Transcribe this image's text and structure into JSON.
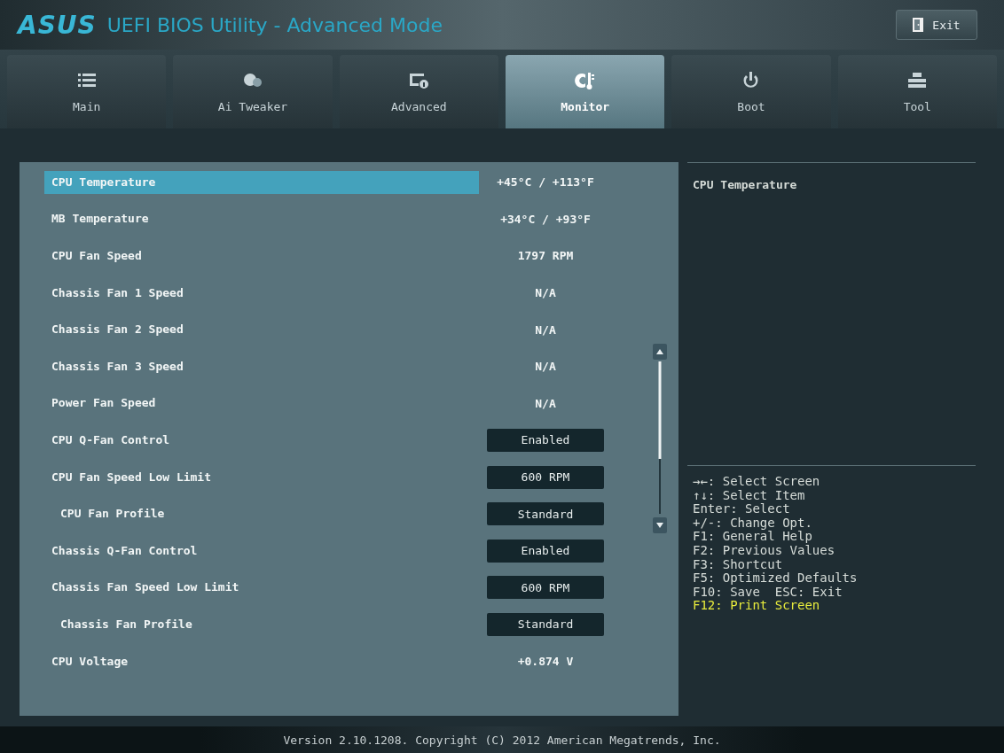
{
  "window": {
    "logo": "ASUS",
    "title": "UEFI BIOS Utility - Advanced Mode",
    "exit_button": "Exit"
  },
  "tabs": [
    {
      "label": "Main",
      "kind": "list",
      "selected": false
    },
    {
      "label": "Ai Tweaker",
      "kind": "tweak",
      "selected": false
    },
    {
      "label": "Advanced",
      "kind": "advanced",
      "selected": false
    },
    {
      "label": "Monitor",
      "kind": "monitor",
      "selected": true
    },
    {
      "label": "Boot",
      "kind": "power",
      "selected": false
    },
    {
      "label": "Tool",
      "kind": "tool",
      "selected": false
    }
  ],
  "settings": [
    {
      "label": "CPU Temperature",
      "kind": "info",
      "value": "+45°C / +113°F",
      "indented": false,
      "selected": true
    },
    {
      "label": "MB Temperature",
      "kind": "info",
      "value": "+34°C / +93°F",
      "indented": false,
      "selected": false
    },
    {
      "label": "CPU Fan Speed",
      "kind": "info",
      "value": "1797 RPM",
      "indented": false,
      "selected": false
    },
    {
      "label": "Chassis Fan 1 Speed",
      "kind": "info",
      "value": "N/A",
      "indented": false,
      "selected": false
    },
    {
      "label": "Chassis Fan 2 Speed",
      "kind": "info",
      "value": "N/A",
      "indented": false,
      "selected": false
    },
    {
      "label": "Chassis Fan 3 Speed",
      "kind": "info",
      "value": "N/A",
      "indented": false,
      "selected": false
    },
    {
      "label": "Power Fan Speed",
      "kind": "info",
      "value": "N/A",
      "indented": false,
      "selected": false
    },
    {
      "label": "CPU Q-Fan Control",
      "kind": "option",
      "value": "Enabled",
      "indented": false,
      "selected": false
    },
    {
      "label": "CPU Fan Speed Low Limit",
      "kind": "option",
      "value": "600 RPM",
      "indented": false,
      "selected": false
    },
    {
      "label": "CPU Fan Profile",
      "kind": "option",
      "value": "Standard",
      "indented": true,
      "selected": false
    },
    {
      "label": "Chassis Q-Fan Control",
      "kind": "option",
      "value": "Enabled",
      "indented": false,
      "selected": false
    },
    {
      "label": "Chassis Fan Speed Low Limit",
      "kind": "option",
      "value": "600 RPM",
      "indented": false,
      "selected": false
    },
    {
      "label": "Chassis Fan Profile",
      "kind": "option",
      "value": "Standard",
      "indented": true,
      "selected": false
    },
    {
      "label": "CPU Voltage",
      "kind": "info",
      "value": "+0.874 V",
      "indented": false,
      "selected": false
    }
  ],
  "help": {
    "title": "CPU Temperature"
  },
  "key_hints": [
    {
      "text": "→←: Select Screen",
      "color": "#d6dcd8"
    },
    {
      "text": "↑↓: Select Item",
      "color": "#d6dcd8"
    },
    {
      "text": "Enter: Select",
      "color": "#d6dcd8"
    },
    {
      "text": "+/-: Change Opt.",
      "color": "#d6dcd8"
    },
    {
      "text": "F1: General Help",
      "color": "#d6dcd8"
    },
    {
      "text": "F2: Previous Values",
      "color": "#d6dcd8"
    },
    {
      "text": "F3: Shortcut",
      "color": "#d6dcd8"
    },
    {
      "text": "F5: Optimized Defaults",
      "color": "#d6dcd8"
    },
    {
      "text": "F10: Save  ESC: Exit",
      "color": "#d6dcd8"
    },
    {
      "text": "F12: Print Screen",
      "color": "#e8ec3c"
    }
  ],
  "status_bar": {
    "version": "Version 2.10.1208. Copyright (C) 2012 American Megatrends, Inc."
  }
}
